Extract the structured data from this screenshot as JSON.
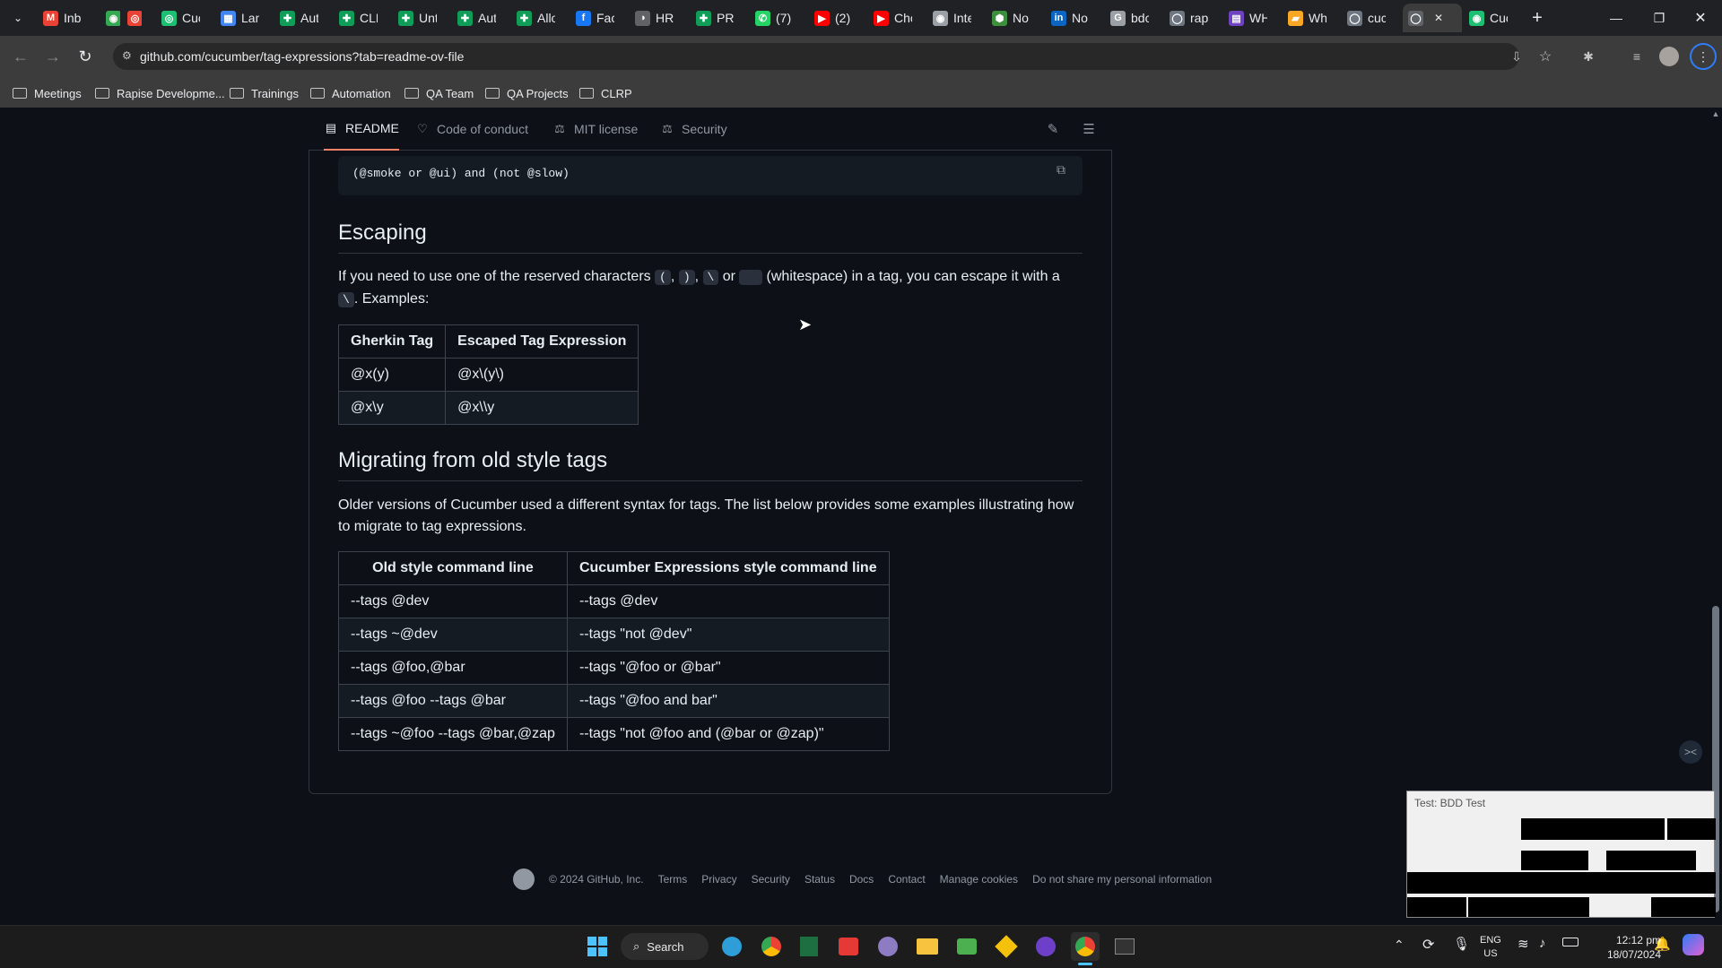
{
  "browser": {
    "tabs": [
      {
        "label": "Inb",
        "color": "#ea4335",
        "glyph": "M"
      },
      {
        "label": "",
        "color": "#34a853",
        "glyph": "◉"
      },
      {
        "label": "",
        "color": "#ea4335",
        "glyph": "◎"
      },
      {
        "label": "Cuc",
        "color": "#1dbf73",
        "glyph": "◎"
      },
      {
        "label": "Lan",
        "color": "#4285f4",
        "glyph": "▦"
      },
      {
        "label": "Aut",
        "color": "#0f9d58",
        "glyph": "✚"
      },
      {
        "label": "CLR",
        "color": "#0f9d58",
        "glyph": "✚"
      },
      {
        "label": "Unt",
        "color": "#0f9d58",
        "glyph": "✚"
      },
      {
        "label": "Aut",
        "color": "#0f9d58",
        "glyph": "✚"
      },
      {
        "label": "Allo",
        "color": "#0f9d58",
        "glyph": "✚"
      },
      {
        "label": "Fac",
        "color": "#1877f2",
        "glyph": "f"
      },
      {
        "label": "HR\\",
        "color": "#5f6368",
        "glyph": "◑"
      },
      {
        "label": "PRI",
        "color": "#0f9d58",
        "glyph": "✚"
      },
      {
        "label": "(7)",
        "color": "#25d366",
        "glyph": "✆"
      },
      {
        "label": "(2)",
        "color": "#ff0000",
        "glyph": "▶"
      },
      {
        "label": "Cho",
        "color": "#ff0000",
        "glyph": "▶"
      },
      {
        "label": "Inte",
        "color": "#9aa0a6",
        "glyph": "◉"
      },
      {
        "label": "No",
        "color": "#3c8f3c",
        "glyph": "⬢"
      },
      {
        "label": "No",
        "color": "#0a66c2",
        "glyph": "in"
      },
      {
        "label": "bdc",
        "color": "#9aa0a6",
        "glyph": "G"
      },
      {
        "label": "rapi",
        "color": "#6e7681",
        "glyph": "◯"
      },
      {
        "label": "WH",
        "color": "#6f42c1",
        "glyph": "▤"
      },
      {
        "label": "Wh",
        "color": "#f9a825",
        "glyph": "▰"
      },
      {
        "label": "cuc",
        "color": "#6e7681",
        "glyph": "◯"
      },
      {
        "label": "",
        "color": "#5f6368",
        "glyph": "◯"
      },
      {
        "label": "Cuc",
        "color": "#1dbf73",
        "glyph": "◉"
      }
    ],
    "url": "github.com/cucumber/tag-expressions?tab=readme-ov-file",
    "bookmarks": [
      "Meetings",
      "Rapise Developme...",
      "Trainings",
      "Automation",
      "QA Team",
      "QA Projects",
      "CLRP"
    ]
  },
  "readme": {
    "tabs": [
      "README",
      "Code of conduct",
      "MIT license",
      "Security"
    ],
    "code_block": "(@smoke or @ui) and (not @slow)",
    "escaping": {
      "heading": "Escaping",
      "intro_before": "If you need to use one of the reserved characters",
      "char1": "(",
      "char2": ")",
      "char3": "\\",
      "or_text": "or",
      "intro_mid": "(whitespace) in a tag, you can escape it with a",
      "char4": "\\",
      "intro_end": ". Examples:",
      "headers": [
        "Gherkin Tag",
        "Escaped Tag Expression"
      ],
      "rows": [
        [
          "@x(y)",
          "@x\\(y\\)"
        ],
        [
          "@x\\y",
          "@x\\\\y"
        ]
      ]
    },
    "migrating": {
      "heading": "Migrating from old style tags",
      "intro": "Older versions of Cucumber used a different syntax for tags. The list below provides some examples illustrating how to migrate to tag expressions.",
      "headers": [
        "Old style command line",
        "Cucumber Expressions style command line"
      ],
      "rows": [
        [
          "--tags @dev",
          "--tags @dev"
        ],
        [
          "--tags ~@dev",
          "--tags \"not @dev\""
        ],
        [
          "--tags @foo,@bar",
          "--tags \"@foo or @bar\""
        ],
        [
          "--tags @foo --tags @bar",
          "--tags \"@foo and bar\""
        ],
        [
          "--tags ~@foo --tags @bar,@zap",
          "--tags \"not @foo and (@bar or @zap)\""
        ]
      ]
    }
  },
  "footer": {
    "copyright": "© 2024 GitHub, Inc.",
    "links": [
      "Terms",
      "Privacy",
      "Security",
      "Status",
      "Docs",
      "Contact",
      "Manage cookies",
      "Do not share my personal information"
    ]
  },
  "overlay": {
    "title": "Test: BDD Test"
  },
  "taskbar": {
    "search": "Search",
    "lang1": "ENG",
    "lang2": "US",
    "time": "12:12 pm",
    "date": "18/07/2024"
  }
}
